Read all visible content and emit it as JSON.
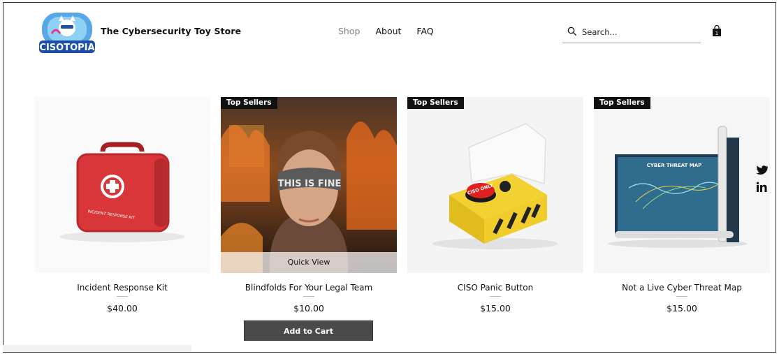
{
  "header": {
    "logo_text": "CISOTOPIA",
    "store_name": "The Cybersecurity Toy Store",
    "nav": [
      {
        "label": "Shop",
        "active": true
      },
      {
        "label": "About",
        "active": false
      },
      {
        "label": "FAQ",
        "active": false
      }
    ],
    "search_placeholder": "Search...",
    "cart_count": "1"
  },
  "products": [
    {
      "name": "Incident Response Kit",
      "price": "$40.00",
      "badge": "",
      "image_text": "INCIDENT RESPONSE KIT"
    },
    {
      "name": "Blindfolds For Your Legal Team",
      "price": "$10.00",
      "badge": "Top Sellers",
      "image_text": "THIS IS FINE",
      "quick_view": "Quick View",
      "add_to_cart": "Add to Cart"
    },
    {
      "name": "CISO Panic Button",
      "price": "$15.00",
      "badge": "Top Sellers",
      "image_text": "CISO ONLY"
    },
    {
      "name": "Not a Live Cyber Threat Map",
      "price": "$15.00",
      "badge": "Top Sellers",
      "image_text": "CYBER THREAT MAP"
    }
  ],
  "colors": {
    "accent_dark": "#111111",
    "button": "#4a4a4a",
    "nav_active": "#888888"
  },
  "social": [
    "twitter-icon",
    "linkedin-icon"
  ]
}
